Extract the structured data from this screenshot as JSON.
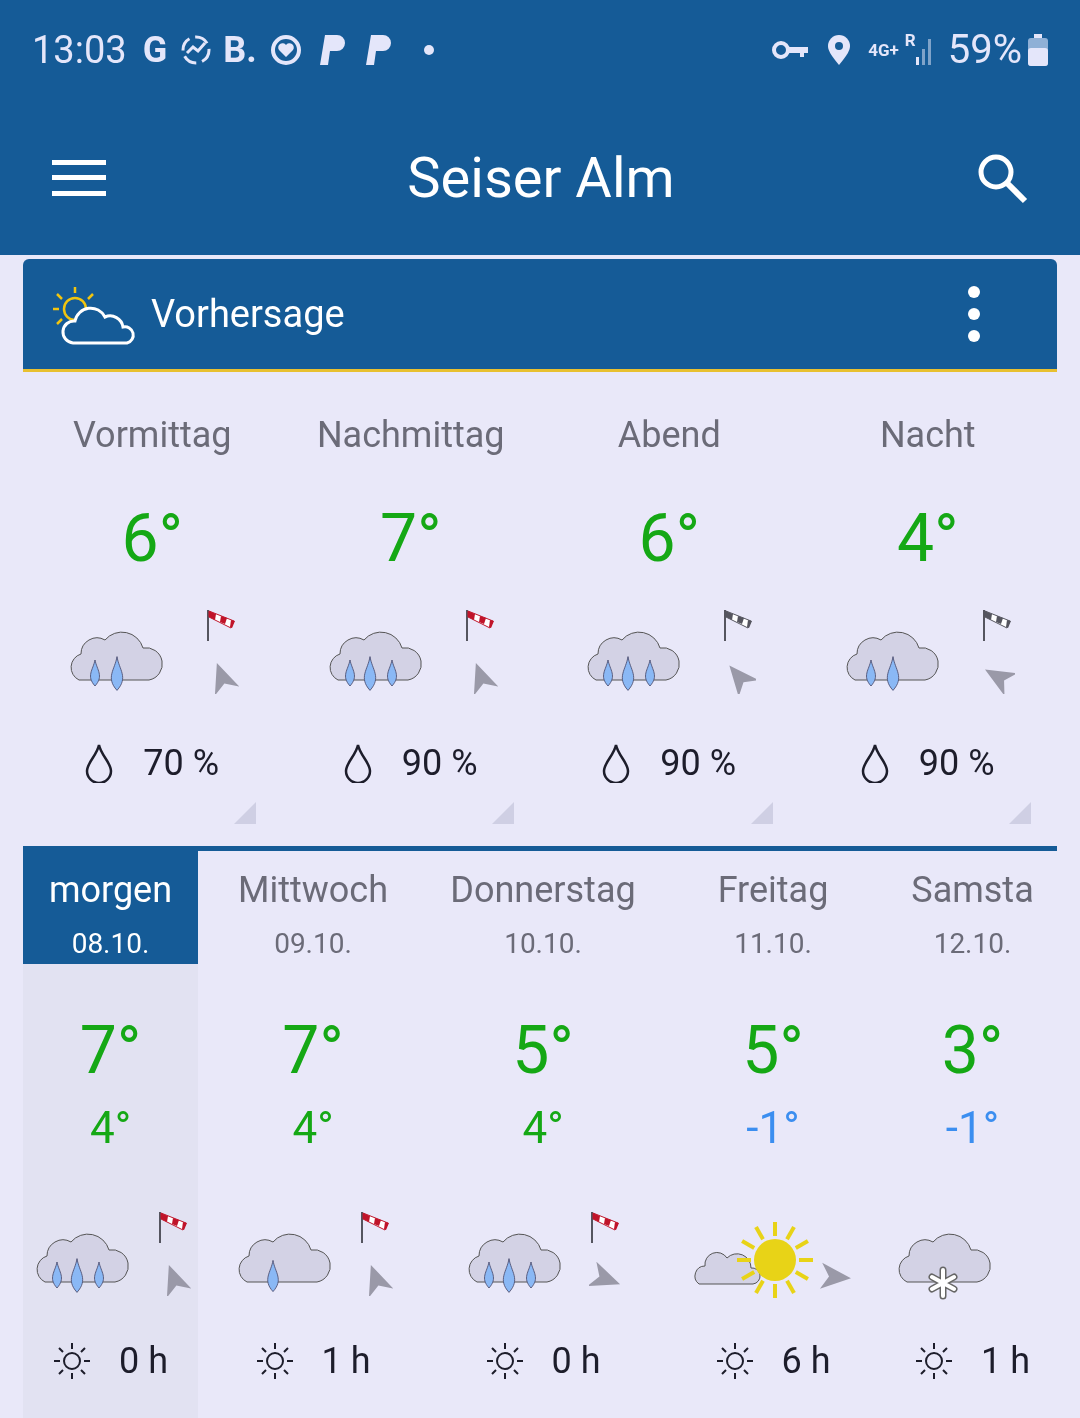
{
  "status_bar": {
    "time": "13:03",
    "google_glyph": "G",
    "booking_glyph": "B.",
    "network": "4G+",
    "roaming": "R",
    "battery": "59%"
  },
  "app_bar": {
    "title": "Seiser Alm"
  },
  "card": {
    "title": "Vorhersage"
  },
  "periods": [
    {
      "label": "Vormittag",
      "temp": "6°",
      "weather": {
        "kind": "rain2"
      },
      "gusty": true,
      "wind": {
        "kind": "nnw"
      },
      "rain": "70 %"
    },
    {
      "label": "Nachmittag",
      "temp": "7°",
      "weather": {
        "kind": "rain3"
      },
      "gusty": true,
      "wind": {
        "kind": "nnw"
      },
      "rain": "90 %"
    },
    {
      "label": "Abend",
      "temp": "6°",
      "weather": {
        "kind": "rain3"
      },
      "gusty": false,
      "wind": {
        "kind": "nw"
      },
      "rain": "90 %"
    },
    {
      "label": "Nacht",
      "temp": "4°",
      "weather": {
        "kind": "rain2"
      },
      "gusty": false,
      "wind": {
        "kind": "wnw"
      },
      "rain": "90 %"
    }
  ],
  "days": [
    {
      "name": "morgen",
      "date": "08.10.",
      "selected": true,
      "high": "7°",
      "low": "4°",
      "frost": false,
      "weather": {
        "kind": "rain3"
      },
      "gusty": true,
      "wind": {
        "kind": "nnw"
      },
      "sun": "0 h"
    },
    {
      "name": "Mittwoch",
      "date": "09.10.",
      "selected": false,
      "high": "7°",
      "low": "4°",
      "frost": false,
      "weather": {
        "kind": "rain1"
      },
      "gusty": true,
      "wind": {
        "kind": "nnw"
      },
      "sun": "1 h"
    },
    {
      "name": "Donnerstag",
      "date": "10.10.",
      "selected": false,
      "high": "5°",
      "low": "4°",
      "frost": false,
      "weather": {
        "kind": "rain3"
      },
      "gusty": true,
      "wind": {
        "kind": "ese"
      },
      "sun": "0 h"
    },
    {
      "name": "Freitag",
      "date": "11.10.",
      "selected": false,
      "high": "5°",
      "low": "-1°",
      "frost": true,
      "weather": {
        "kind": "sunny"
      },
      "wind": {
        "kind": "e"
      },
      "sun": "6 h"
    },
    {
      "name": "Samsta",
      "date": "12.10.",
      "selected": false,
      "high": "3°",
      "low": "-1°",
      "frost": true,
      "weather": {
        "kind": "snow"
      },
      "sun": "1 h"
    }
  ]
}
